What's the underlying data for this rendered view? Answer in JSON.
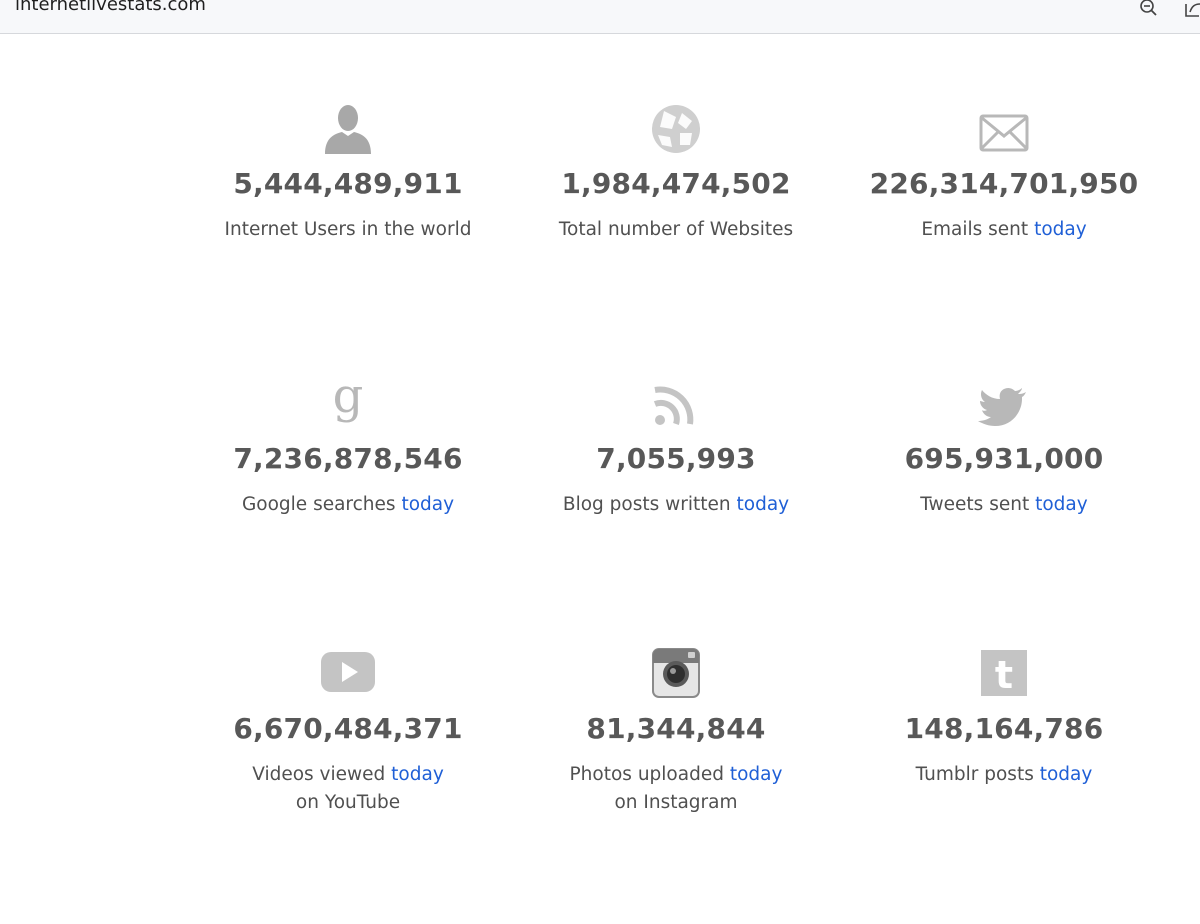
{
  "browser": {
    "url": "internetlivestats.com",
    "zoom_icon": "zoom-out-icon",
    "share_icon": "share-icon"
  },
  "colors": {
    "number": "#585858",
    "label": "#505050",
    "link": "#1f5fd6",
    "icon": "#bdbdbd"
  },
  "stats": [
    {
      "icon": "user-icon",
      "value": "5,444,489,911",
      "label": "Internet Users in the world",
      "link": "",
      "label2": ""
    },
    {
      "icon": "globe-icon",
      "value": "1,984,474,502",
      "label": "Total number of Websites",
      "link": "",
      "label2": ""
    },
    {
      "icon": "envelope-icon",
      "value": "226,314,701,950",
      "label": "Emails sent",
      "link": "today",
      "label2": ""
    },
    {
      "icon": "google-g-icon",
      "value": "7,236,878,546",
      "label": "Google searches",
      "link": "today",
      "label2": ""
    },
    {
      "icon": "rss-icon",
      "value": "7,055,993",
      "label": "Blog posts written",
      "link": "today",
      "label2": ""
    },
    {
      "icon": "twitter-bird-icon",
      "value": "695,931,000",
      "label": "Tweets sent",
      "link": "today",
      "label2": ""
    },
    {
      "icon": "youtube-icon",
      "value": "6,670,484,371",
      "label": "Videos viewed",
      "link": "today",
      "label2": "on YouTube"
    },
    {
      "icon": "instagram-icon",
      "value": "81,344,844",
      "label": "Photos uploaded",
      "link": "today",
      "label2": "on Instagram"
    },
    {
      "icon": "tumblr-icon",
      "value": "148,164,786",
      "label": "Tumblr posts",
      "link": "today",
      "label2": ""
    }
  ]
}
